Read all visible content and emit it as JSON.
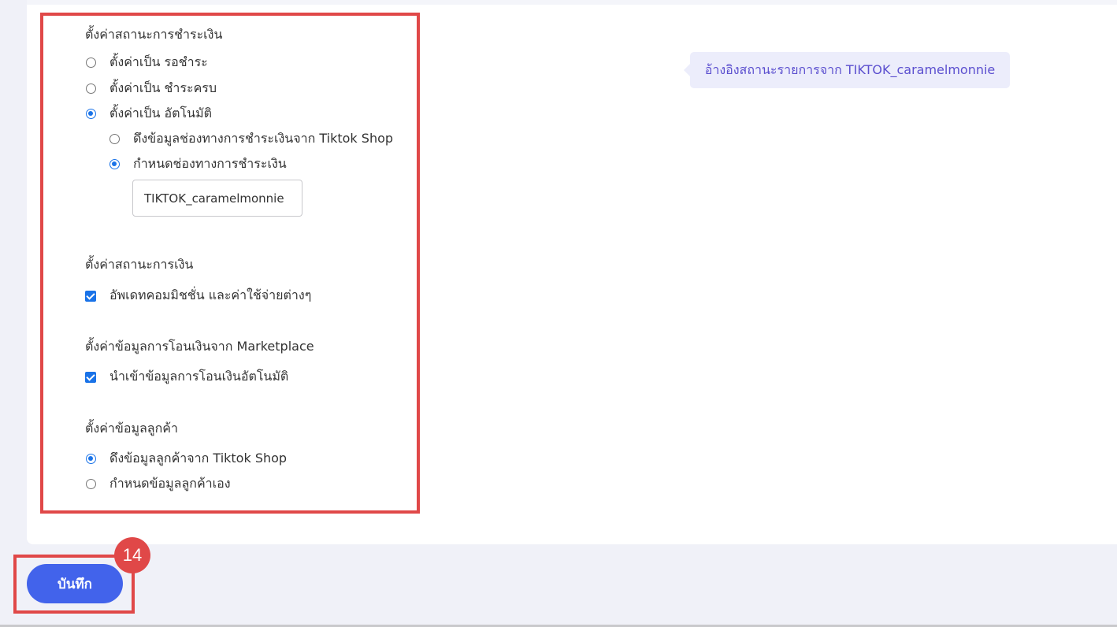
{
  "payment_status": {
    "title": "ตั้งค่าสถานะการชำระเงิน",
    "options": [
      {
        "label": "ตั้งค่าเป็น รอชำระ",
        "checked": false
      },
      {
        "label": "ตั้งค่าเป็น ชำระครบ",
        "checked": false
      },
      {
        "label": "ตั้งค่าเป็น อัตโนมัติ",
        "checked": true
      }
    ],
    "sub_options": [
      {
        "label": "ดึงข้อมูลช่องทางการชำระเงินจาก Tiktok Shop",
        "checked": false
      },
      {
        "label": "กำหนดช่องทางการชำระเงิน",
        "checked": true
      }
    ],
    "channel_value": "TIKTOK_caramelmonnie"
  },
  "tooltip": {
    "text": "อ้างอิงสถานะรายการจาก TIKTOK_caramelmonnie"
  },
  "finance_status": {
    "title": "ตั้งค่าสถานะการเงิน",
    "checkbox_label": "อัพเดทคอมมิชชั่น และค่าใช้จ่ายต่างๆ",
    "checked": true
  },
  "marketplace_transfer": {
    "title": "ตั้งค่าข้อมูลการโอนเงินจาก Marketplace",
    "checkbox_label": "นำเข้าข้อมูลการโอนเงินอัตโนมัติ",
    "checked": true
  },
  "customer_info": {
    "title": "ตั้งค่าข้อมูลลูกค้า",
    "options": [
      {
        "label": "ดึงข้อมูลลูกค้าจาก Tiktok Shop",
        "checked": true
      },
      {
        "label": "กำหนดข้อมูลลูกค้าเอง",
        "checked": false
      }
    ]
  },
  "footer": {
    "save_label": "บันทึก",
    "step_number": "14"
  },
  "colors": {
    "accent": "#4263eb",
    "radio_checked": "#1a73e8",
    "highlight_border": "#e04848",
    "tooltip_bg": "#ecedfb",
    "tooltip_text": "#5b4fcf"
  }
}
